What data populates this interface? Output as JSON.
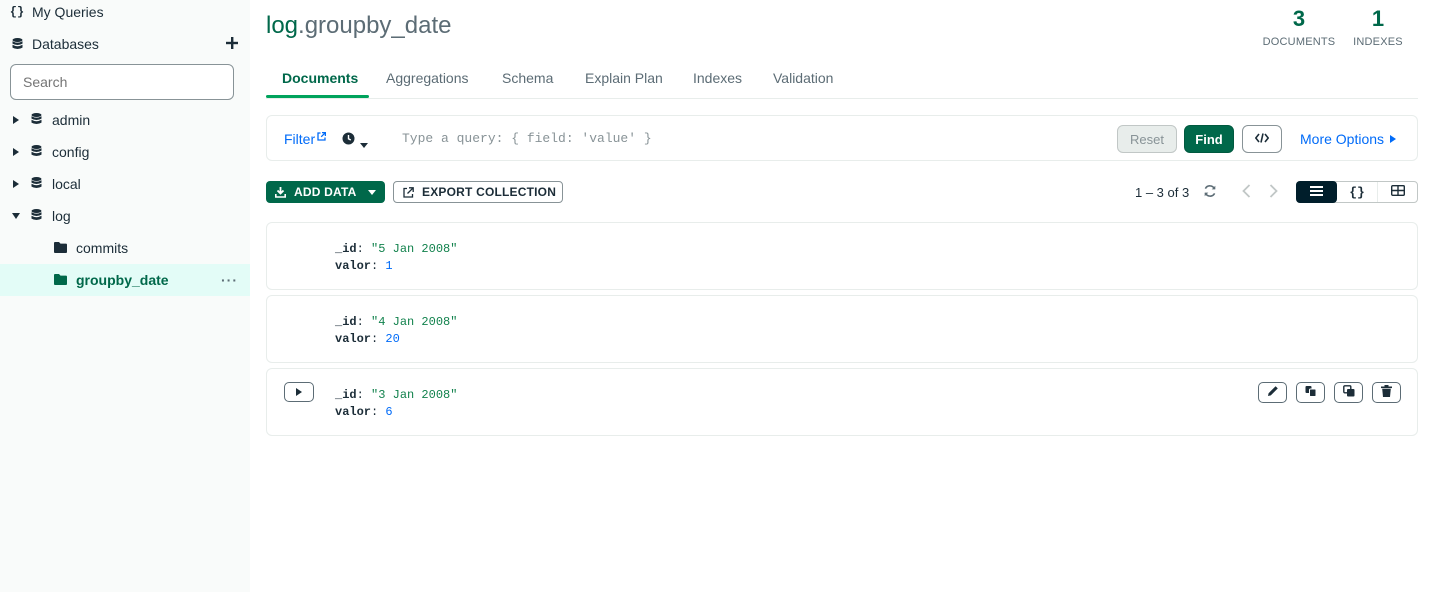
{
  "sidebar": {
    "my_queries": "My Queries",
    "databases": "Databases",
    "search_placeholder": "Search",
    "databases_list": [
      {
        "label": "admin"
      },
      {
        "label": "config"
      },
      {
        "label": "local"
      },
      {
        "label": "log"
      }
    ],
    "collections": [
      {
        "label": "commits"
      },
      {
        "label": "groupby_date"
      }
    ],
    "more": "···"
  },
  "header": {
    "db": "log",
    "collection": ".groupby_date",
    "documents_count": "3",
    "documents_label": "DOCUMENTS",
    "indexes_count": "1",
    "indexes_label": "INDEXES"
  },
  "tabs": [
    {
      "label": "Documents"
    },
    {
      "label": "Aggregations"
    },
    {
      "label": "Schema"
    },
    {
      "label": "Explain Plan"
    },
    {
      "label": "Indexes"
    },
    {
      "label": "Validation"
    }
  ],
  "query": {
    "filter_label": "Filter",
    "placeholder": "Type a query: { field: 'value' }",
    "reset_label": "Reset",
    "find_label": "Find",
    "more_options": "More Options"
  },
  "toolbar": {
    "add_data": "ADD DATA",
    "export_collection": "EXPORT COLLECTION",
    "pagination": "1 – 3 of 3"
  },
  "documents": [
    {
      "id_key": "_id",
      "id_value": "\"5 Jan 2008\"",
      "valor_key": "valor",
      "valor_value": "1"
    },
    {
      "id_key": "_id",
      "id_value": "\"4 Jan 2008\"",
      "valor_key": "valor",
      "valor_value": "20"
    },
    {
      "id_key": "_id",
      "id_value": "\"3 Jan 2008\"",
      "valor_key": "valor",
      "valor_value": "6"
    }
  ],
  "colors": {
    "brand_green": "#00684a",
    "link_blue": "#016bf8",
    "string_green": "#12824d",
    "sidebar_active_bg": "#e3fcf7"
  }
}
